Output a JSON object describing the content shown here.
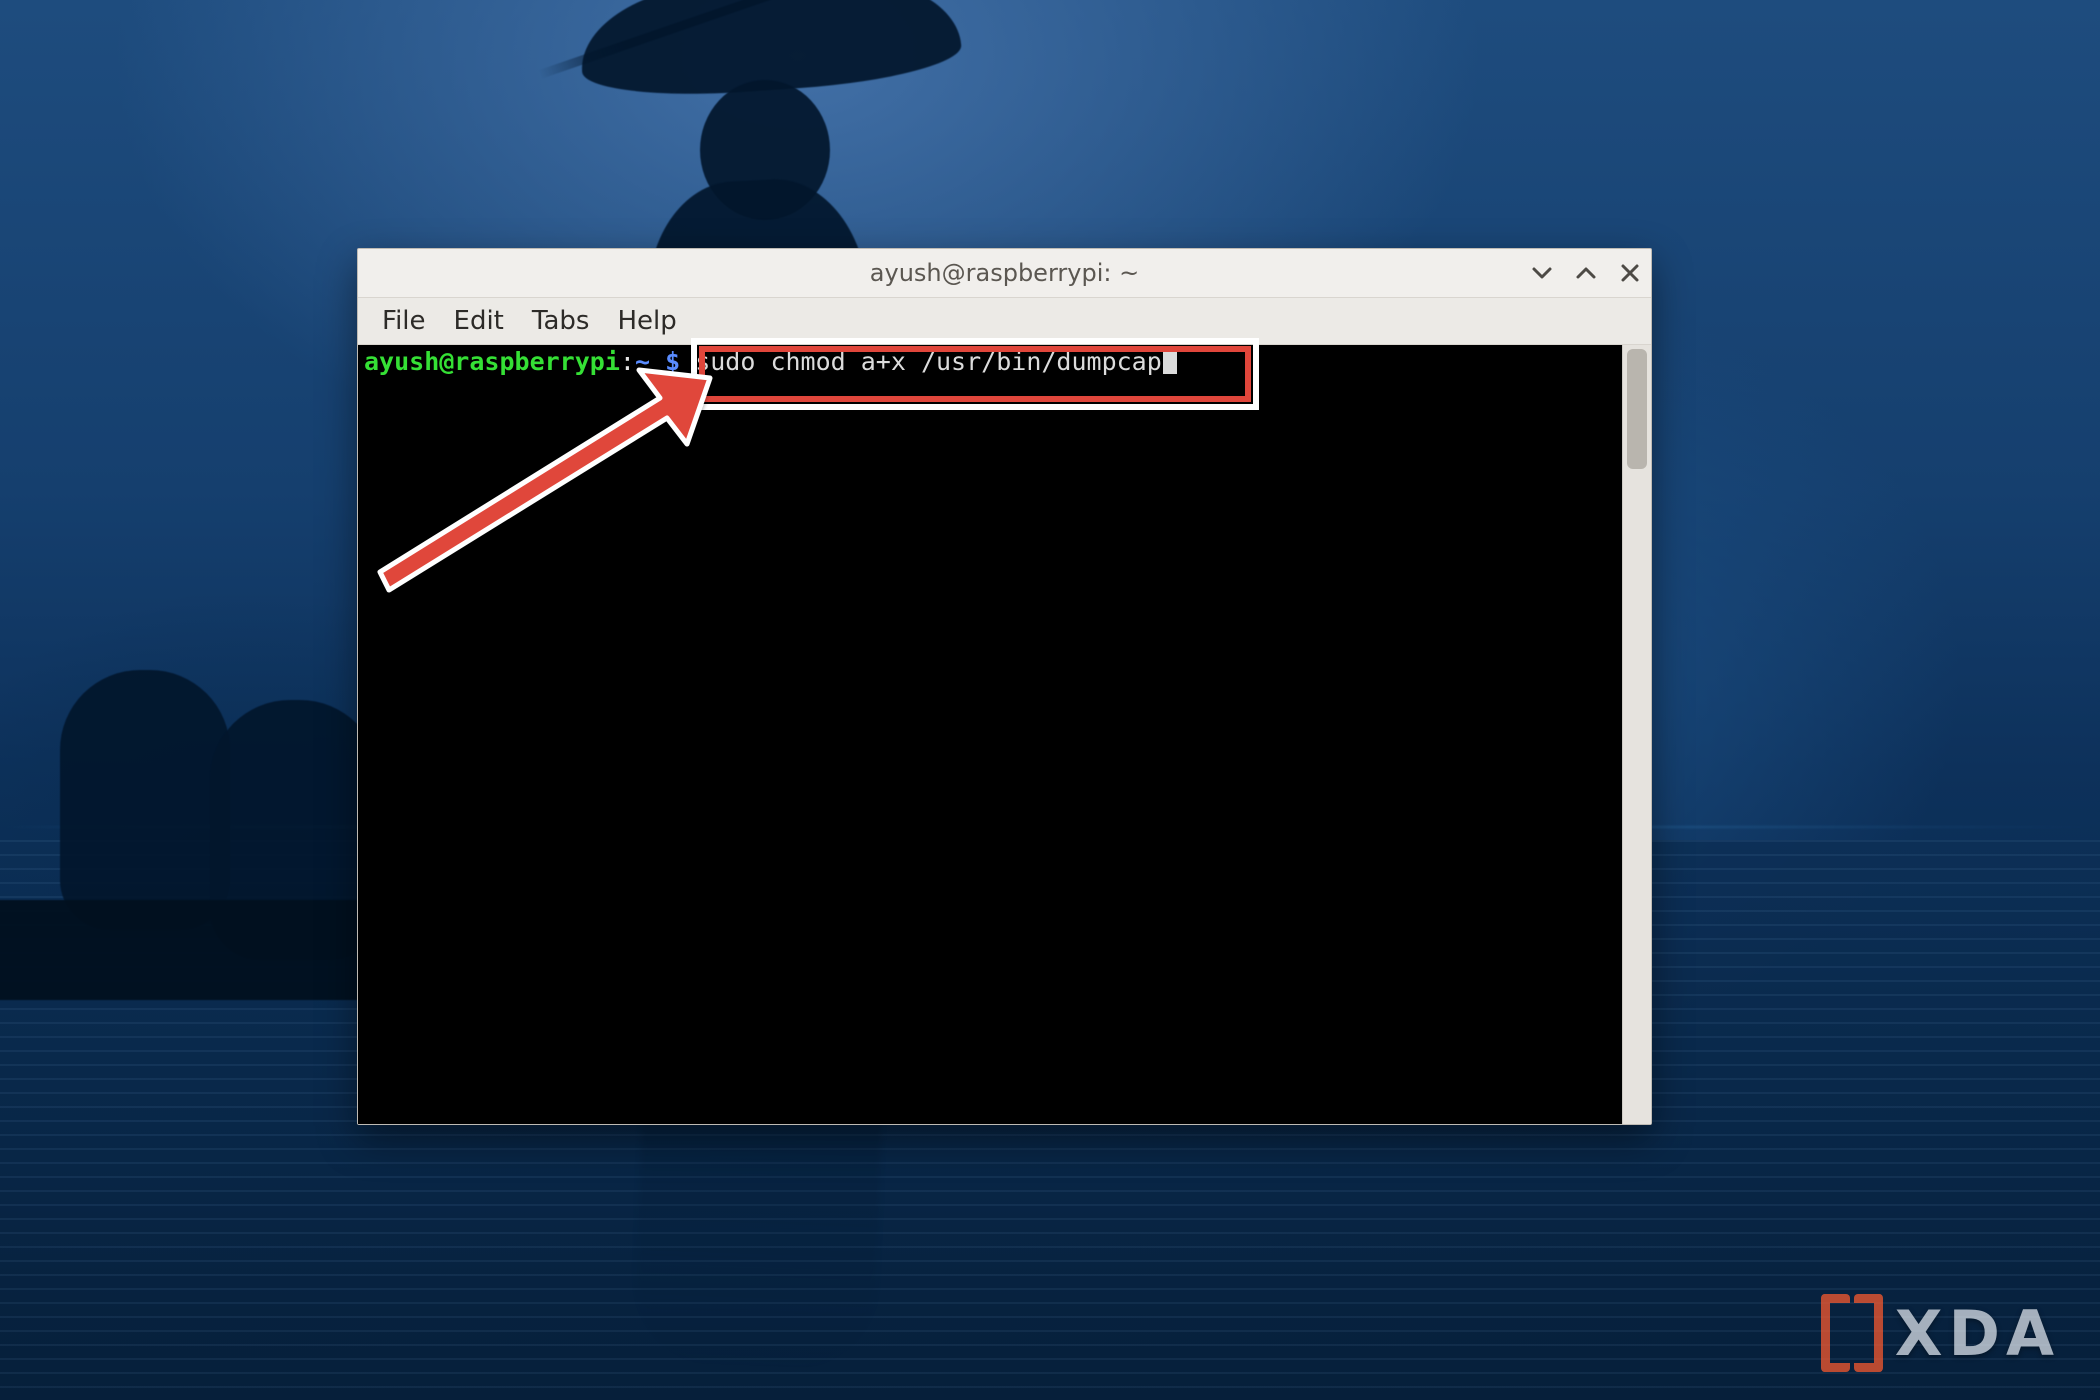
{
  "window": {
    "title": "ayush@raspberrypi: ~"
  },
  "menubar": {
    "items": [
      "File",
      "Edit",
      "Tabs",
      "Help"
    ]
  },
  "prompt": {
    "user_host": "ayush@raspberrypi",
    "separator": ":",
    "path": "~",
    "symbol": "$"
  },
  "command": {
    "text": "sudo chmod a+x /usr/bin/dumpcap"
  },
  "annotation": {
    "highlighted_command": "sudo chmod a+x /usr/bin/dumpcap",
    "box_color": "#e0463b",
    "arrow_color": "#e0463b"
  },
  "watermark": {
    "text": "XDA"
  }
}
